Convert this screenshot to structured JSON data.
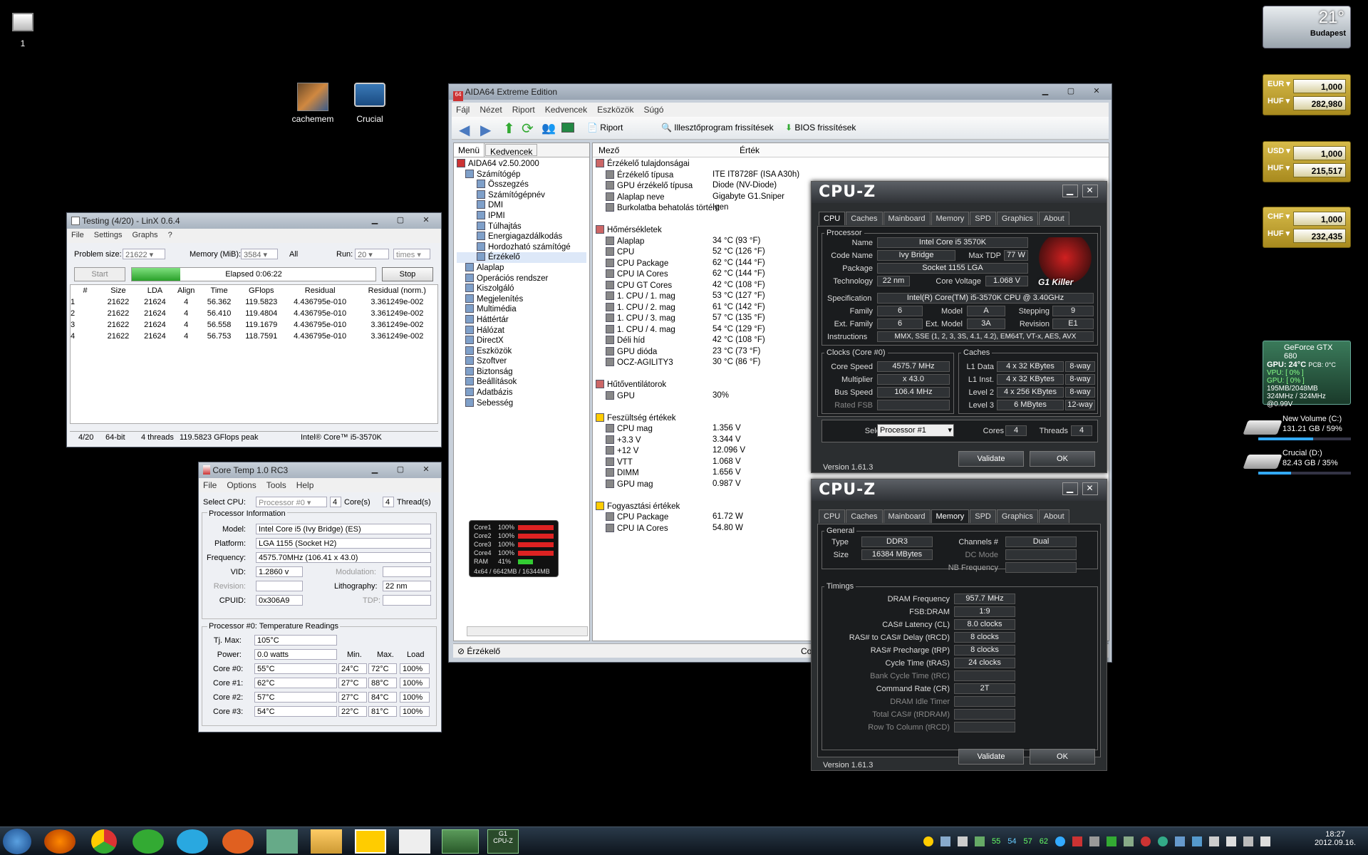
{
  "desktop": {
    "icons": [
      {
        "label": "1"
      },
      {
        "label": "cachemem"
      },
      {
        "label": "Crucial"
      }
    ]
  },
  "weather": {
    "temp": "21°",
    "city": "Budapest"
  },
  "currency": [
    {
      "from": "EUR",
      "from_val": "1,000",
      "to": "HUF",
      "to_val": "282,980"
    },
    {
      "from": "USD",
      "from_val": "1,000",
      "to": "HUF",
      "to_val": "215,517"
    },
    {
      "from": "CHF",
      "from_val": "1,000",
      "to": "HUF",
      "to_val": "232,435"
    }
  ],
  "gpu_gadget": {
    "title": "GeForce GTX 680",
    "gpu_temp": "GPU: 24°C",
    "pcb": "PCB: 0°C",
    "vpu": "VPU: [ 0% ]",
    "gpu_load": "GPU: [ 0% ]",
    "mem": "195MB/2048MB",
    "clock": "324MHz / 324MHz @0.99V"
  },
  "drives": [
    {
      "name": "New Volume (C:)",
      "info": "131.21 GB / 59%",
      "fill": 0.59
    },
    {
      "name": "Crucial (D:)",
      "info": "82.43 GB / 35%",
      "fill": 0.35
    }
  ],
  "linx": {
    "title": "Testing (4/20) - LinX 0.6.4",
    "menu": [
      "File",
      "Settings",
      "Graphs",
      "?"
    ],
    "problem_size_label": "Problem size:",
    "problem_size": "21622",
    "memory_label": "Memory (MiB):",
    "memory": "3584",
    "all": "All",
    "run_label": "Run:",
    "run": "20",
    "times": "times",
    "start": "Start",
    "elapsed": "Elapsed 0:06:22",
    "stop": "Stop",
    "progress": 0.2,
    "headers": [
      "#",
      "Size",
      "LDA",
      "Align",
      "Time",
      "GFlops",
      "Residual",
      "Residual (norm.)"
    ],
    "rows": [
      [
        "1",
        "21622",
        "21624",
        "4",
        "56.362",
        "119.5823",
        "4.436795e-010",
        "3.361249e-002"
      ],
      [
        "2",
        "21622",
        "21624",
        "4",
        "56.410",
        "119.4804",
        "4.436795e-010",
        "3.361249e-002"
      ],
      [
        "3",
        "21622",
        "21624",
        "4",
        "56.558",
        "119.1679",
        "4.436795e-010",
        "3.361249e-002"
      ],
      [
        "4",
        "21622",
        "21624",
        "4",
        "56.753",
        "118.7591",
        "4.436795e-010",
        "3.361249e-002"
      ]
    ],
    "status": [
      "4/20",
      "64-bit",
      "4 threads",
      "119.5823 GFlops peak",
      "Intel® Core™ i5-3570K"
    ]
  },
  "coretemp": {
    "title": "Core Temp 1.0 RC3",
    "menu": [
      "File",
      "Options",
      "Tools",
      "Help"
    ],
    "select_cpu": "Select CPU:",
    "cpu": "Processor #0",
    "cores": "4",
    "cores_lbl": "Core(s)",
    "threads": "4",
    "threads_lbl": "Thread(s)",
    "info_title": "Processor Information",
    "model_lbl": "Model:",
    "model": "Intel Core i5 (Ivy Bridge)  (ES)",
    "platform_lbl": "Platform:",
    "platform": "LGA 1155 (Socket H2)",
    "freq_lbl": "Frequency:",
    "freq": "4575.70MHz (106.41 x 43.0)",
    "vid_lbl": "VID:",
    "vid": "1.2860 v",
    "mod_lbl": "Modulation:",
    "rev_lbl": "Revision:",
    "litho_lbl": "Lithography:",
    "litho": "22 nm",
    "cpuid_lbl": "CPUID:",
    "cpuid": "0x306A9",
    "tdp_lbl": "TDP:",
    "temp_title": "Processor #0: Temperature Readings",
    "tjmax_lbl": "Tj. Max:",
    "tjmax": "105°C",
    "power_lbl": "Power:",
    "power": "0.0 watts",
    "cols": [
      "Min.",
      "Max.",
      "Load"
    ],
    "cores_rows": [
      [
        "Core #0:",
        "55°C",
        "24°C",
        "72°C",
        "100%"
      ],
      [
        "Core #1:",
        "62°C",
        "27°C",
        "88°C",
        "100%"
      ],
      [
        "Core #2:",
        "57°C",
        "27°C",
        "84°C",
        "100%"
      ],
      [
        "Core #3:",
        "54°C",
        "22°C",
        "81°C",
        "100%"
      ]
    ]
  },
  "minigadget": {
    "rows": [
      [
        "Core1",
        "100%"
      ],
      [
        "Core2",
        "100%"
      ],
      [
        "Core3",
        "100%"
      ],
      [
        "Core4",
        "100%"
      ],
      [
        "RAM",
        "41%"
      ]
    ],
    "footer": "4x64 / 6642MB / 16344MB"
  },
  "aida": {
    "title": "AIDA64 Extreme Edition",
    "menu": [
      "Fájl",
      "Nézet",
      "Riport",
      "Kedvencek",
      "Eszközök",
      "Súgó"
    ],
    "toolbar": {
      "report": "Riport",
      "driver": "Illesztőprogram frissítések",
      "bios": "BIOS frissítések"
    },
    "tabs": [
      "Menü",
      "Kedvencek"
    ],
    "col_field": "Mező",
    "col_value": "Érték",
    "tree": [
      "AIDA64 v2.50.2000",
      "Számítógép",
      "Összegzés",
      "Számítógépnév",
      "DMI",
      "IPMI",
      "Túlhajtás",
      "Energiagazdálkodás",
      "Hordozható számítógé",
      "Érzékelő",
      "Alaplap",
      "Operációs rendszer",
      "Kiszolgáló",
      "Megjelenítés",
      "Multimédia",
      "Háttértár",
      "Hálózat",
      "DirectX",
      "Eszközök",
      "Szoftver",
      "Biztonság",
      "Beállítások",
      "Adatbázis",
      "Sebesség"
    ],
    "status": "Érzékelő",
    "status_right": "Cop",
    "list": [
      {
        "s": "Érzékelő tulajdonságai"
      },
      {
        "f": "Érzékelő típusa",
        "v": "ITE IT8728F  (ISA A30h)"
      },
      {
        "f": "GPU érzékelő típusa",
        "v": "Diode  (NV-Diode)"
      },
      {
        "f": "Alaplap neve",
        "v": "Gigabyte G1.Sniper"
      },
      {
        "f": "Burkolatba behatolás történt",
        "v": "Igen"
      },
      {
        "s": ""
      },
      {
        "s": "Hőmérsékletek"
      },
      {
        "f": "Alaplap",
        "v": "34 °C  (93 °F)"
      },
      {
        "f": "CPU",
        "v": "52 °C  (126 °F)"
      },
      {
        "f": "CPU Package",
        "v": "62 °C  (144 °F)"
      },
      {
        "f": "CPU IA Cores",
        "v": "62 °C  (144 °F)"
      },
      {
        "f": "CPU GT Cores",
        "v": "42 °C  (108 °F)"
      },
      {
        "f": "1. CPU / 1. mag",
        "v": "53 °C  (127 °F)"
      },
      {
        "f": "1. CPU / 2. mag",
        "v": "61 °C  (142 °F)"
      },
      {
        "f": "1. CPU / 3. mag",
        "v": "57 °C  (135 °F)"
      },
      {
        "f": "1. CPU / 4. mag",
        "v": "54 °C  (129 °F)"
      },
      {
        "f": "Déli híd",
        "v": "42 °C  (108 °F)"
      },
      {
        "f": "GPU dióda",
        "v": "23 °C  (73 °F)"
      },
      {
        "f": "OCZ-AGILITY3",
        "v": "30 °C  (86 °F)"
      },
      {
        "s": ""
      },
      {
        "s": "Hűtőventilátorok"
      },
      {
        "f": "GPU",
        "v": "30%"
      },
      {
        "s": ""
      },
      {
        "s": "Feszültség értékek"
      },
      {
        "f": "CPU mag",
        "v": "1.356 V"
      },
      {
        "f": "+3.3 V",
        "v": "3.344 V"
      },
      {
        "f": "+12 V",
        "v": "12.096 V"
      },
      {
        "f": "VTT",
        "v": "1.068 V"
      },
      {
        "f": "DIMM",
        "v": "1.656 V"
      },
      {
        "f": "GPU mag",
        "v": "0.987 V"
      },
      {
        "s": ""
      },
      {
        "s": "Fogyasztási értékek"
      },
      {
        "f": "CPU Package",
        "v": "61.72 W"
      },
      {
        "f": "CPU IA Cores",
        "v": "54.80 W"
      }
    ]
  },
  "cpuz1": {
    "logo": "CPU-Z",
    "tabs": [
      "CPU",
      "Caches",
      "Mainboard",
      "Memory",
      "SPD",
      "Graphics",
      "About"
    ],
    "processor": "Processor",
    "name_lbl": "Name",
    "name": "Intel Core i5 3570K",
    "code_lbl": "Code Name",
    "code": "Ivy Bridge",
    "tdp_lbl": "Max TDP",
    "tdp": "77 W",
    "pkg_lbl": "Package",
    "pkg": "Socket 1155 LGA",
    "tech_lbl": "Technology",
    "tech": "22 nm",
    "cv_lbl": "Core Voltage",
    "cv": "1.068 V",
    "spec_lbl": "Specification",
    "spec": "Intel(R) Core(TM) i5-3570K CPU @ 3.40GHz",
    "fam_lbl": "Family",
    "fam": "6",
    "model_lbl": "Model",
    "model": "A",
    "step_lbl": "Stepping",
    "step": "9",
    "efam_lbl": "Ext. Family",
    "efam": "6",
    "emod_lbl": "Ext. Model",
    "emod": "3A",
    "rev_lbl": "Revision",
    "rev": "E1",
    "instr_lbl": "Instructions",
    "instr": "MMX, SSE (1, 2, 3, 3S, 4.1, 4.2), EM64T, VT-x, AES, AVX",
    "clocks": "Clocks (Core #0)",
    "cs_lbl": "Core Speed",
    "cs": "4575.7 MHz",
    "mul_lbl": "Multiplier",
    "mul": "x 43.0",
    "bus_lbl": "Bus Speed",
    "bus": "106.4 MHz",
    "fsb_lbl": "Rated FSB",
    "caches": "Caches",
    "l1d_lbl": "L1 Data",
    "l1d": "4 x 32 KBytes",
    "l1d_w": "8-way",
    "l1i_lbl": "L1 Inst.",
    "l1i": "4 x 32 KBytes",
    "l1i_w": "8-way",
    "l2_lbl": "Level 2",
    "l2": "4 x 256 KBytes",
    "l2_w": "8-way",
    "l3_lbl": "Level 3",
    "l3": "6 MBytes",
    "l3_w": "12-way",
    "sel_lbl": "Selection",
    "sel": "Processor #1",
    "cores_lbl": "Cores",
    "cores": "4",
    "thr_lbl": "Threads",
    "thr": "4",
    "version": "Version 1.61.3",
    "validate": "Validate",
    "ok": "OK",
    "brand": "G1 Killer"
  },
  "cpuz2": {
    "logo": "CPU-Z",
    "tabs": [
      "CPU",
      "Caches",
      "Mainboard",
      "Memory",
      "SPD",
      "Graphics",
      "About"
    ],
    "general": "General",
    "type_lbl": "Type",
    "type": "DDR3",
    "size_lbl": "Size",
    "size": "16384 MBytes",
    "ch_lbl": "Channels #",
    "ch": "Dual",
    "dc_lbl": "DC Mode",
    "nb_lbl": "NB Frequency",
    "timings": "Timings",
    "rows": [
      [
        "DRAM Frequency",
        "957.7 MHz"
      ],
      [
        "FSB:DRAM",
        "1:9"
      ],
      [
        "CAS# Latency (CL)",
        "8.0 clocks"
      ],
      [
        "RAS# to CAS# Delay (tRCD)",
        "8 clocks"
      ],
      [
        "RAS# Precharge (tRP)",
        "8 clocks"
      ],
      [
        "Cycle Time (tRAS)",
        "24 clocks"
      ],
      [
        "Bank Cycle Time (tRC)",
        ""
      ],
      [
        "Command Rate (CR)",
        "2T"
      ],
      [
        "DRAM Idle Timer",
        ""
      ],
      [
        "Total CAS# (tRDRAM)",
        ""
      ],
      [
        "Row To Column (tRCD)",
        ""
      ]
    ],
    "version": "Version 1.61.3",
    "validate": "Validate",
    "ok": "OK"
  },
  "taskbar": {
    "time": "18:27",
    "date": "2012.09.16.",
    "tray_nums": [
      "55",
      "54",
      "57",
      "62"
    ]
  }
}
